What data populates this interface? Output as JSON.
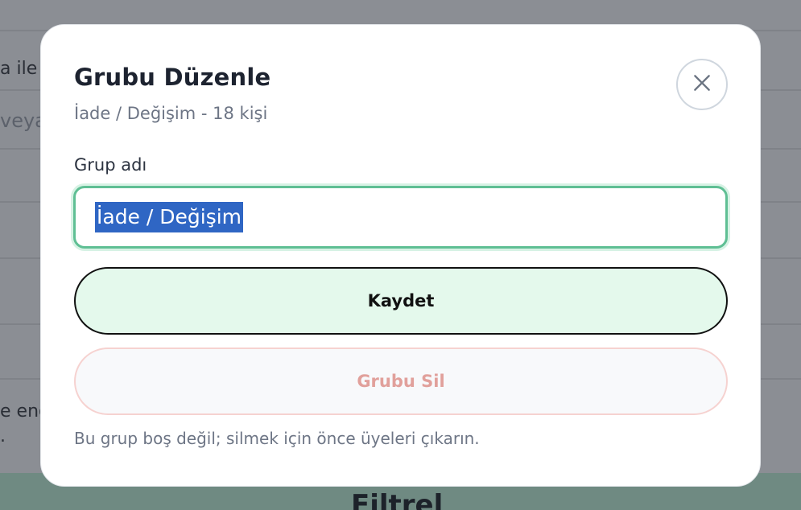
{
  "background": {
    "row_1_text": "a ile",
    "row_2_text": "veya",
    "row_7_text_a": "e eng",
    "row_7_text_b": ".",
    "footer_text": "Filtrel"
  },
  "modal": {
    "title": "Grubu Düzenle",
    "subtitle": "İade / Değişim - 18 kişi",
    "close_icon": "close-icon",
    "field_label": "Grup adı",
    "group_name_value": "İade / Değişim",
    "save_label": "Kaydet",
    "delete_label": "Grubu Sil",
    "hint": "Bu grup boş değil; silmek için önce üyeleri çıkarın."
  },
  "colors": {
    "accent_green": "#5fbf94",
    "save_bg": "#e4f9ec",
    "delete_text": "#e1a09b",
    "selection": "#2f66c4"
  }
}
